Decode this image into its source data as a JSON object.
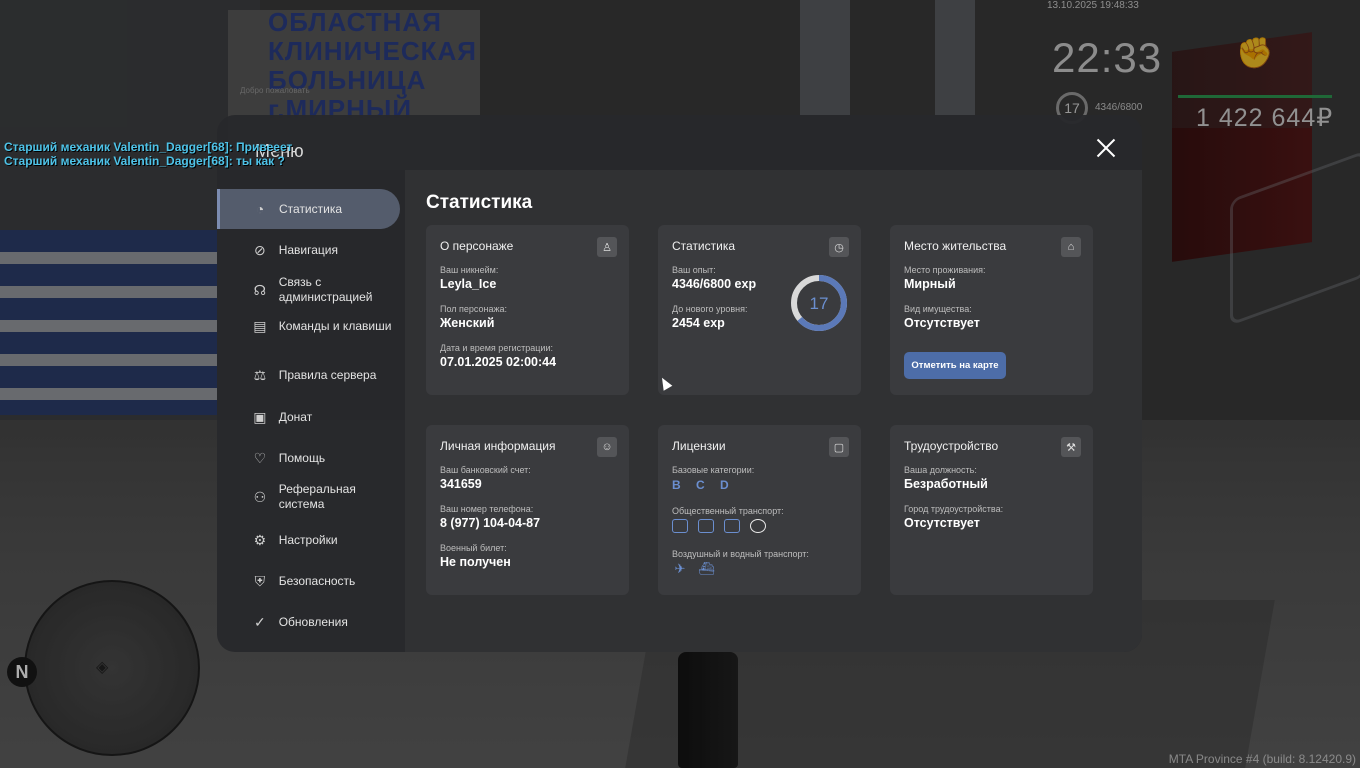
{
  "background": {
    "sign_lines": [
      "ОБЛАСТНАЯ",
      "КЛИНИЧЕСКАЯ",
      "БОЛЬНИЦА",
      "г.МИРНЫЙ"
    ],
    "sign_small": "Добро пожаловать"
  },
  "hud": {
    "date": "13.10.2025 19:48:33",
    "time": "22:33",
    "level": "17",
    "exp": "4346/6800",
    "money": "1 422 644₽",
    "build": "MTA Province #4 (build: 8.12420.9)",
    "fist_icon": "fist-icon"
  },
  "chat": [
    "Старший механик Valentin_Dagger[68]: Привееет",
    "Старший механик Valentin_Dagger[68]: ты как ?"
  ],
  "minimap": {
    "north": "N"
  },
  "menu": {
    "title": "Меню",
    "sidebar": [
      {
        "label": "Статистика",
        "icon": "pie-chart-icon",
        "glyph": "◔",
        "active": true
      },
      {
        "label": "Навигация",
        "icon": "compass-icon",
        "glyph": "⊘"
      },
      {
        "label": "Связь с администрацией",
        "icon": "headset-icon",
        "glyph": "☊"
      },
      {
        "label": "Команды и клавиши",
        "icon": "document-icon",
        "glyph": "▤"
      },
      {
        "label": "Правила сервера",
        "icon": "scales-icon",
        "glyph": "⚖"
      },
      {
        "label": "Донат",
        "icon": "wallet-icon",
        "glyph": "▣"
      },
      {
        "label": "Помощь",
        "icon": "handshake-icon",
        "glyph": "♡"
      },
      {
        "label": "Реферальная система",
        "icon": "network-icon",
        "glyph": "⚇"
      },
      {
        "label": "Настройки",
        "icon": "gear-icon",
        "glyph": "⚙"
      },
      {
        "label": "Безопасность",
        "icon": "shield-icon",
        "glyph": "⛨"
      },
      {
        "label": "Обновления",
        "icon": "refresh-check-icon",
        "glyph": "✓"
      }
    ],
    "content_title": "Статистика",
    "cards": {
      "character": {
        "title": "О персонаже",
        "nick_label": "Ваш никнейм:",
        "nick": "Leyla_Ice",
        "gender_label": "Пол персонажа:",
        "gender": "Женский",
        "reg_label": "Дата и время регистрации:",
        "reg": "07.01.2025 02:00:44"
      },
      "stats": {
        "title": "Статистика",
        "exp_label": "Ваш опыт:",
        "exp": "4346/6800 exp",
        "next_label": "До нового уровня:",
        "next": "2454 exp",
        "level": "17",
        "level_progress": 0.639
      },
      "residence": {
        "title": "Место жительства",
        "place_label": "Место проживания:",
        "place": "Мирный",
        "property_label": "Вид имущества:",
        "property": "Отсутствует",
        "map_button": "Отметить на карте"
      },
      "personal": {
        "title": "Личная информация",
        "bank_label": "Ваш банковский счет:",
        "bank": "341659",
        "phone_label": "Ваш номер телефона:",
        "phone": "8 (977) 104-04-87",
        "military_label": "Военный билет:",
        "military": "Не получен"
      },
      "licenses": {
        "title": "Лицензии",
        "base_label": "Базовые категории:",
        "categories": [
          "B",
          "C",
          "D"
        ],
        "public_label": "Общественный транспорт:",
        "air_label": "Воздушный и водный транспорт:"
      },
      "employment": {
        "title": "Трудоустройство",
        "position_label": "Ваша должность:",
        "position": "Безработный",
        "city_label": "Город трудоустройства:",
        "city": "Отсутствует"
      }
    }
  },
  "colors": {
    "accent": "#4d6da8",
    "chat": "#4ec3e8",
    "progress": "#5b79b8"
  }
}
